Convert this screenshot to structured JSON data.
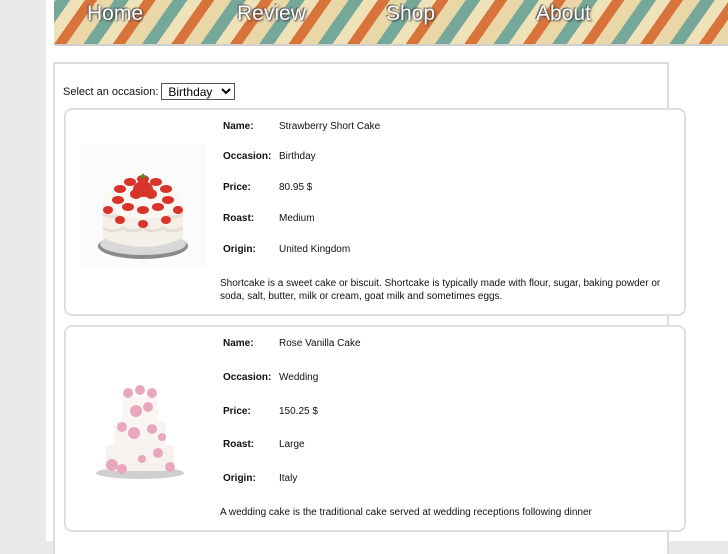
{
  "nav": {
    "items": [
      {
        "label": "Home"
      },
      {
        "label": "Review"
      },
      {
        "label": "Shop"
      },
      {
        "label": "About"
      }
    ]
  },
  "filter": {
    "label": "Select an occasion:",
    "selected": "Birthday"
  },
  "labels": {
    "name": "Name:",
    "occasion": "Occasion:",
    "price": "Price:",
    "roast": "Roast:",
    "origin": "Origin:"
  },
  "cakes": [
    {
      "image_icon": "strawberry-cake-icon",
      "name": "Strawberry Short Cake",
      "occasion": "Birthday",
      "price": "80.95 $",
      "roast": "Medium",
      "origin": "United Kingdom",
      "description": "Shortcake is a sweet cake or biscuit. Shortcake is typically made with flour, sugar, baking powder or soda, salt, butter, milk or cream, goat milk and sometimes eggs."
    },
    {
      "image_icon": "wedding-cake-icon",
      "name": "Rose Vanilla Cake",
      "occasion": "Wedding",
      "price": "150.25 $",
      "roast": "Large",
      "origin": "Italy",
      "description": "A wedding cake is the traditional cake served at wedding receptions following dinner"
    }
  ]
}
